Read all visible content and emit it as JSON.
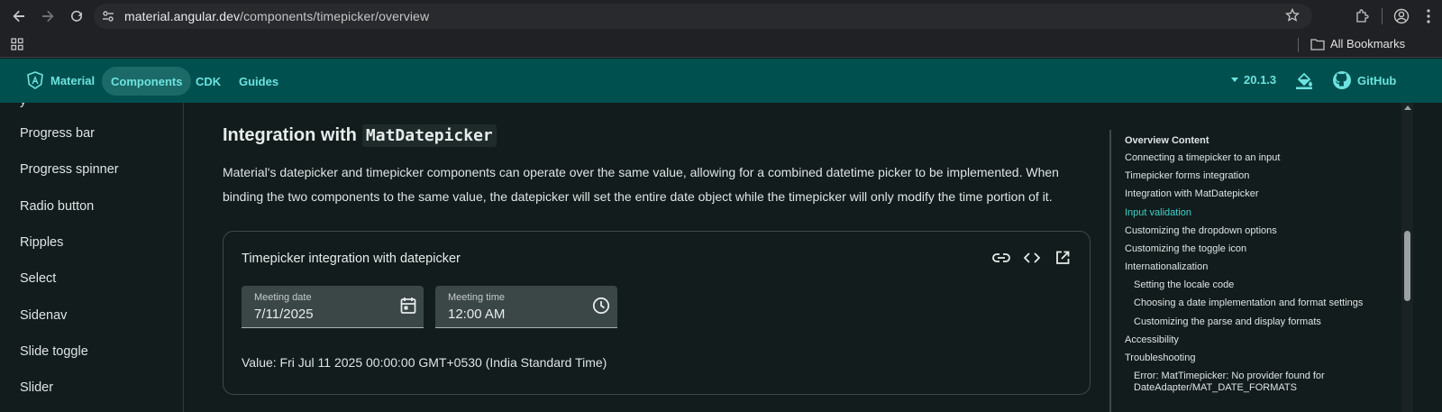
{
  "browser": {
    "url_host": "material.angular.dev",
    "url_path": "/components/timepicker/overview",
    "bookmarks_label": "All Bookmarks"
  },
  "toolbar": {
    "brand": "Material",
    "nav": [
      "Components",
      "CDK",
      "Guides"
    ],
    "active_nav": "Components",
    "version": "20.1.3",
    "github": "GitHub",
    "accent": "#6ee3df",
    "background": "#00504f"
  },
  "sidebar": {
    "items": [
      "Progress bar",
      "Progress spinner",
      "Radio button",
      "Ripples",
      "Select",
      "Sidenav",
      "Slide toggle",
      "Slider"
    ]
  },
  "main": {
    "heading_text": "Integration with",
    "heading_code": "MatDatepicker",
    "paragraph": "Material's datepicker and timepicker components can operate over the same value, allowing for a combined datetime picker to be implemented. When binding the two components to the same value, the datepicker will set the entire date object while the timepicker will only modify the time portion of it.",
    "example": {
      "title": "Timepicker integration with datepicker",
      "date_field": {
        "label": "Meeting date",
        "value": "7/11/2025"
      },
      "time_field": {
        "label": "Meeting time",
        "value": "12:00 AM"
      },
      "value_text": "Value: Fri Jul 11 2025 00:00:00 GMT+0530 (India Standard Time)"
    }
  },
  "toc": {
    "heading": "Overview Content",
    "items": [
      {
        "label": "Connecting a timepicker to an input",
        "level": 1
      },
      {
        "label": "Timepicker forms integration",
        "level": 1
      },
      {
        "label": "Integration with MatDatepicker",
        "level": 1
      },
      {
        "label": "Input validation",
        "level": 1,
        "active": true
      },
      {
        "label": "Customizing the dropdown options",
        "level": 1
      },
      {
        "label": "Customizing the toggle icon",
        "level": 1
      },
      {
        "label": "Internationalization",
        "level": 1
      },
      {
        "label": "Setting the locale code",
        "level": 2
      },
      {
        "label": "Choosing a date implementation and format settings",
        "level": 2
      },
      {
        "label": "Customizing the parse and display formats",
        "level": 2
      },
      {
        "label": "Accessibility",
        "level": 1
      },
      {
        "label": "Troubleshooting",
        "level": 1
      },
      {
        "label": "Error: MatTimepicker: No provider found for",
        "level": 2
      },
      {
        "label": "DateAdapter/MAT_DATE_FORMATS",
        "level": 2
      }
    ]
  }
}
